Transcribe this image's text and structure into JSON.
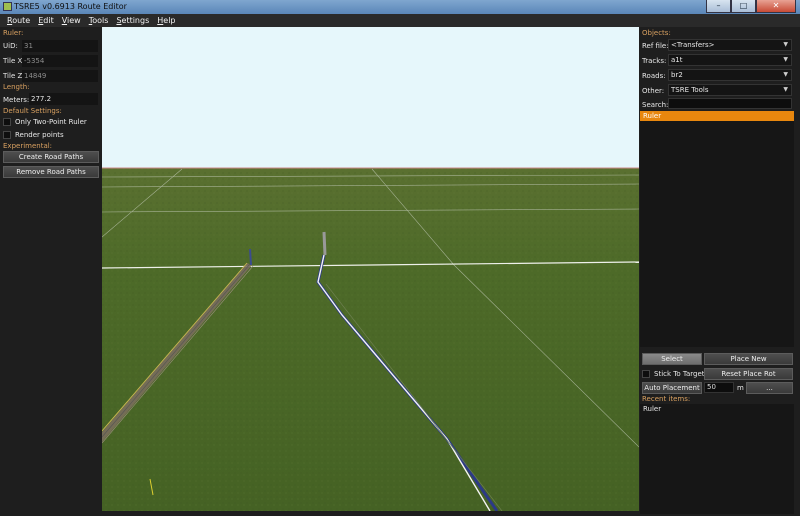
{
  "window": {
    "title": "TSRE5 v0.6913 Route Editor",
    "buttons": {
      "minimize": "–",
      "maximize": "□",
      "close": "✕"
    }
  },
  "menu": [
    {
      "u": "R",
      "rest": "oute"
    },
    {
      "u": "E",
      "rest": "dit"
    },
    {
      "u": "V",
      "rest": "iew"
    },
    {
      "u": "T",
      "rest": "ools"
    },
    {
      "u": "S",
      "rest": "ettings"
    },
    {
      "u": "H",
      "rest": "elp"
    }
  ],
  "left": {
    "ruler_label": "Ruler:",
    "uid_label": "UiD:",
    "uid_value": "31",
    "tilex_label": "Tile X:",
    "tilex_value": "-5354",
    "tilez_label": "Tile Z:",
    "tilez_value": "14849",
    "length_label": "Length:",
    "meters_label": "Meters:",
    "meters_value": "277.2",
    "defaults_label": "Default Settings:",
    "only_two_point": "Only Two-Point Ruler",
    "render_points": "Render points",
    "experimental_label": "Experimental:",
    "create_road_paths": "Create Road Paths",
    "remove_road_paths": "Remove Road Paths"
  },
  "right": {
    "objects_label": "Objects:",
    "ref_label": "Ref file:",
    "ref_value": "<Transfers>",
    "tracks_label": "Tracks:",
    "tracks_value": "a1t",
    "roads_label": "Roads:",
    "roads_value": "br2",
    "other_label": "Other:",
    "other_value": "TSRE Tools",
    "search_label": "Search:",
    "selected_item": "Ruler",
    "select_btn": "Select",
    "place_new_btn": "Place New",
    "stick_to_target": "Stick To Target",
    "reset_place_rot": "Reset Place Rot",
    "auto_placement": "Auto Placement",
    "auto_value": "50",
    "unit_m": "m",
    "dots_btn": "...",
    "recent_label": "Recent items:",
    "recent_items": [
      "Ruler"
    ]
  },
  "colors": {
    "accent_orange": "#e8870e",
    "section_label": "#d8a060",
    "sky": "#e6f7fb",
    "grass": "#4b6a28"
  }
}
